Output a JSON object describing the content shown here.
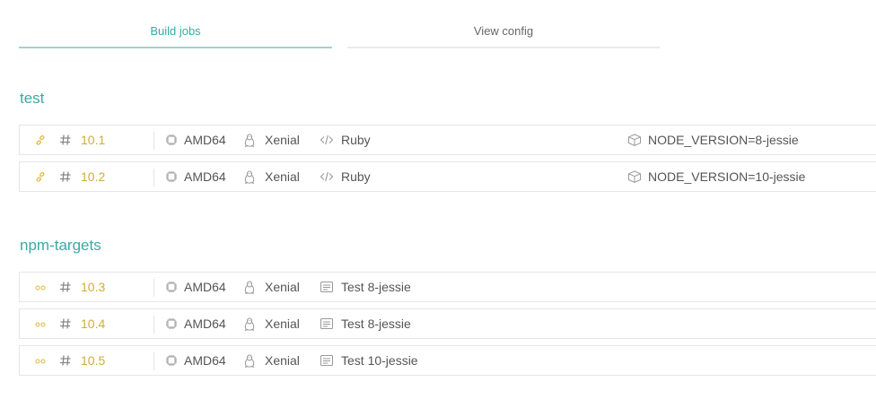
{
  "tabs": {
    "build_jobs": "Build jobs",
    "view_config": "View config"
  },
  "stages": {
    "test": {
      "name": "test",
      "jobs": [
        {
          "number": "10.1",
          "arch": "AMD64",
          "os": "Xenial",
          "language": "Ruby",
          "env": "NODE_VERSION=8-jessie",
          "state": "created"
        },
        {
          "number": "10.2",
          "arch": "AMD64",
          "os": "Xenial",
          "language": "Ruby",
          "env": "NODE_VERSION=10-jessie",
          "state": "created"
        }
      ]
    },
    "npm_targets": {
      "name": "npm-targets",
      "jobs": [
        {
          "number": "10.3",
          "arch": "AMD64",
          "os": "Xenial",
          "job_name": "Test 8-jessie",
          "state": "pending"
        },
        {
          "number": "10.4",
          "arch": "AMD64",
          "os": "Xenial",
          "job_name": "Test 8-jessie",
          "state": "pending"
        },
        {
          "number": "10.5",
          "arch": "AMD64",
          "os": "Xenial",
          "job_name": "Test 10-jessie",
          "state": "pending"
        }
      ]
    }
  },
  "icons": {
    "state_created": "link-icon",
    "state_pending": "pending-dots-icon",
    "hash": "hash-icon",
    "arch": "cpu-chip-icon",
    "os": "linux-penguin-icon",
    "language": "code-brackets-icon",
    "job_name": "document-lines-icon",
    "env": "package-box-icon"
  },
  "colors": {
    "accent": "#39aaa4",
    "job_number": "#cdae3a",
    "state_icon": "#e0b93f"
  }
}
